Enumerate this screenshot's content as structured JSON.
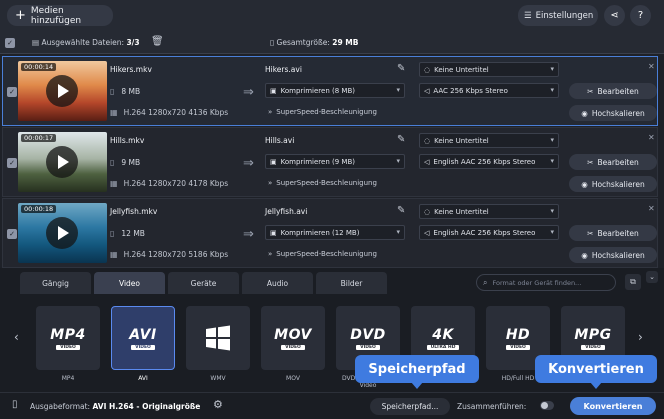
{
  "toolbar": {
    "add_media_label": "Medien hinzufügen",
    "settings_label": "Einstellungen",
    "share_icon": "share-icon",
    "help_label": "?"
  },
  "selection": {
    "selected_label": "Ausgewählte Dateien:",
    "selected_value": "3/3",
    "total_size_label": "Gesamtgröße:",
    "total_size_value": "29 MB"
  },
  "files": [
    {
      "duration": "00:00:14",
      "name": "Hikers.mkv",
      "size": "8 MB",
      "meta": "H.264 1280x720 4136 Kbps",
      "output_name": "Hikers.avi",
      "compress": "Komprimieren (8 MB)",
      "subtitle": "Keine Untertitel",
      "audio": "AAC 256 Kbps Stereo",
      "superspeed": "SuperSpeed-Beschleunigung",
      "edit_label": "Bearbeiten",
      "upscale_label": "Hochskalieren"
    },
    {
      "duration": "00:00:17",
      "name": "Hills.mkv",
      "size": "9 MB",
      "meta": "H.264 1280x720 4178 Kbps",
      "output_name": "Hills.avi",
      "compress": "Komprimieren (9 MB)",
      "subtitle": "Keine Untertitel",
      "audio": "English AAC 256 Kbps Stereo",
      "superspeed": "SuperSpeed-Beschleunigung",
      "edit_label": "Bearbeiten",
      "upscale_label": "Hochskalieren"
    },
    {
      "duration": "00:00:18",
      "name": "Jellyfish.mkv",
      "size": "12 MB",
      "meta": "H.264 1280x720 5186 Kbps",
      "output_name": "Jellyfish.avi",
      "compress": "Komprimieren (12 MB)",
      "subtitle": "Keine Untertitel",
      "audio": "English AAC 256 Kbps Stereo",
      "superspeed": "SuperSpeed-Beschleunigung",
      "edit_label": "Bearbeiten",
      "upscale_label": "Hochskalieren"
    }
  ],
  "tabs": [
    "Gängig",
    "Video",
    "Geräte",
    "Audio",
    "Bilder"
  ],
  "active_tab": "Video",
  "search": {
    "placeholder": "Format oder Gerät finden..."
  },
  "formats": [
    {
      "logo": "MP4",
      "badge": "VIDEO",
      "label": "MP4"
    },
    {
      "logo": "AVI",
      "badge": "VIDEO",
      "label": "AVI"
    },
    {
      "logo": "",
      "badge": "",
      "label": "WMV"
    },
    {
      "logo": "MOV",
      "badge": "VIDEO",
      "label": "MOV"
    },
    {
      "logo": "DVD",
      "badge": "VIDEO",
      "label": "DVD-kompatibles Video"
    },
    {
      "logo": "4K",
      "badge": "ULTRA HD",
      "label": "4K Ultra HD"
    },
    {
      "logo": "HD",
      "badge": "VIDEO",
      "label": "HD/Full HD"
    },
    {
      "logo": "MPG",
      "badge": "VIDEO",
      "label": "MPEG-1, 2"
    }
  ],
  "footer": {
    "output_format_label": "Ausgabeformat:",
    "output_format_value": "AVI H.264 - Originalgröße",
    "save_path_label": "Speicherpfad...",
    "merge_label": "Zusammenführen:",
    "convert_label": "Konvertieren"
  },
  "callouts": {
    "save_path": "Speicherpfad",
    "convert": "Konvertieren"
  },
  "colors": {
    "accent": "#4a7fd8",
    "callout": "#3f7be0",
    "background": "#1e2128"
  }
}
